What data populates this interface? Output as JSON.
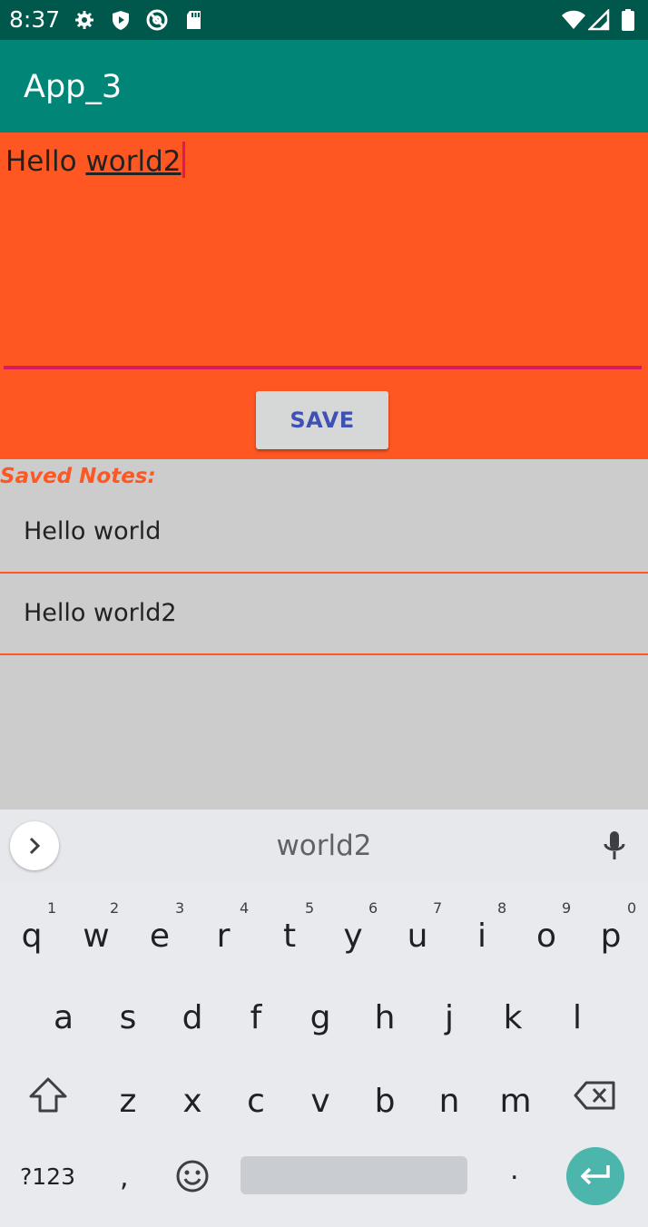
{
  "status_bar": {
    "time": "8:37"
  },
  "app_bar": {
    "title": "App_3"
  },
  "editor": {
    "text_plain": "Hello ",
    "text_underlined": "world2",
    "save_label": "SAVE"
  },
  "saved_notes": {
    "label": "Saved Notes:",
    "items": [
      "Hello world",
      "Hello world2"
    ]
  },
  "keyboard": {
    "suggestion": "world2",
    "row1": [
      {
        "key": "q",
        "hint": "1"
      },
      {
        "key": "w",
        "hint": "2"
      },
      {
        "key": "e",
        "hint": "3"
      },
      {
        "key": "r",
        "hint": "4"
      },
      {
        "key": "t",
        "hint": "5"
      },
      {
        "key": "y",
        "hint": "6"
      },
      {
        "key": "u",
        "hint": "7"
      },
      {
        "key": "i",
        "hint": "8"
      },
      {
        "key": "o",
        "hint": "9"
      },
      {
        "key": "p",
        "hint": "0"
      }
    ],
    "row2": [
      "a",
      "s",
      "d",
      "f",
      "g",
      "h",
      "j",
      "k",
      "l"
    ],
    "row3": [
      "z",
      "x",
      "c",
      "v",
      "b",
      "n",
      "m"
    ],
    "sym_label": "?123",
    "comma": ",",
    "period": "."
  },
  "colors": {
    "status_bar": "#00574b",
    "app_bar": "#008577",
    "accent_orange": "#ff5722",
    "accent_pink": "#d81b60",
    "button_text": "#3f51b5",
    "enter_key": "#4db6ac"
  },
  "icons": [
    "settings-icon",
    "shield-play-icon",
    "at-icon",
    "sd-card-icon",
    "wifi-icon",
    "signal-icon",
    "battery-icon",
    "chevron-right-icon",
    "mic-icon",
    "shift-icon",
    "backspace-icon",
    "emoji-icon",
    "enter-icon"
  ]
}
